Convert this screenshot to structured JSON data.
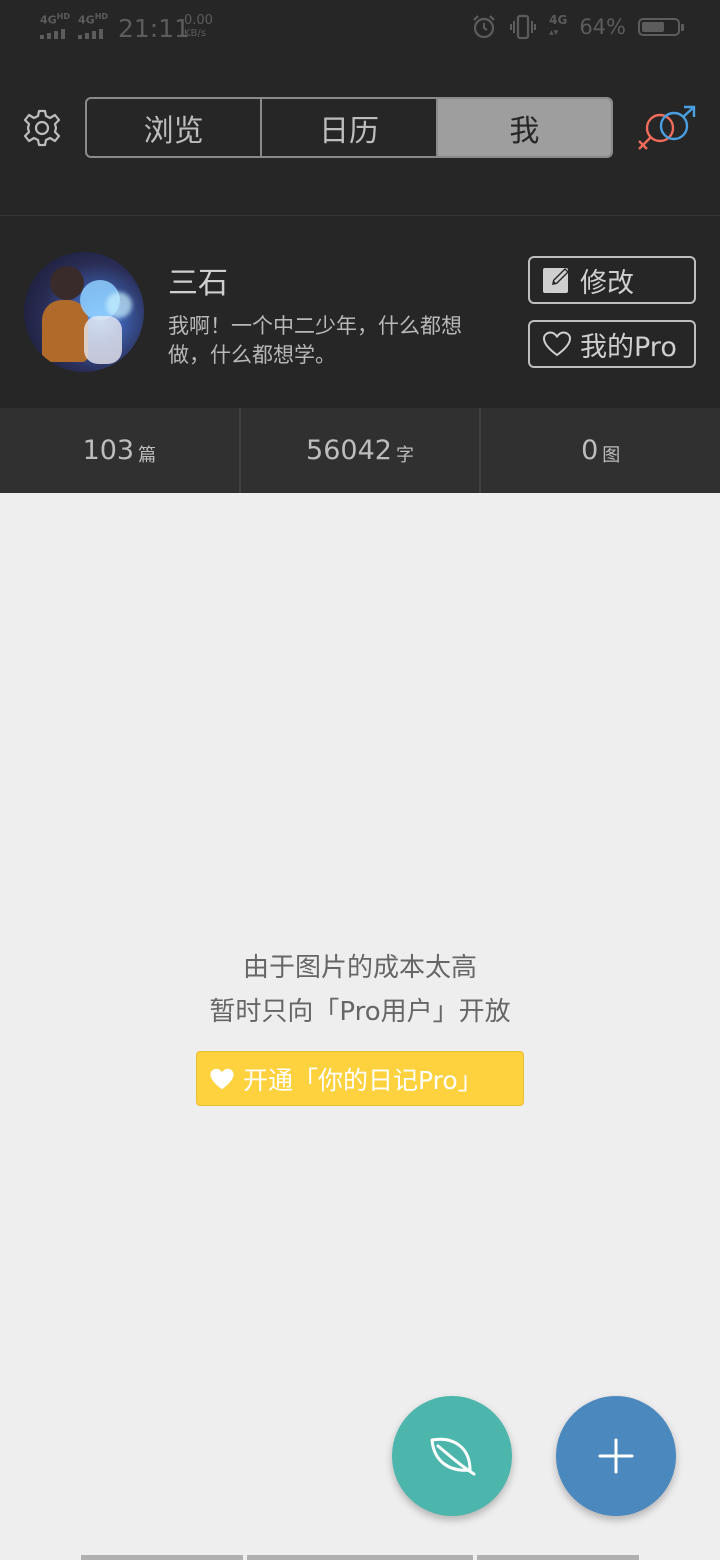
{
  "status_bar": {
    "network1": "4G",
    "network1_sup": "HD",
    "network2": "4G",
    "network2_sup": "HD",
    "time": "21:11",
    "speed_value": "0.00",
    "speed_unit": "KB/s",
    "network3": "4G",
    "battery_percent": "64%",
    "battery_level": 0.64
  },
  "header": {
    "tabs": [
      {
        "label": "浏览",
        "active": false
      },
      {
        "label": "日历",
        "active": false
      },
      {
        "label": "我",
        "active": true
      }
    ],
    "icons": {
      "settings": "gear-icon",
      "gender": "gender-icon"
    }
  },
  "profile": {
    "name": "三石",
    "bio": "我啊！一个中二少年，什么都想做，什么都想学。",
    "edit_label": "修改",
    "pro_label": "我的Pro"
  },
  "stats": [
    {
      "value": "103",
      "unit": "篇"
    },
    {
      "value": "56042",
      "unit": "字"
    },
    {
      "value": "0",
      "unit": "图"
    }
  ],
  "empty_state": {
    "line1": "由于图片的成本太高",
    "line2": "暂时只向「Pro用户」开放",
    "button_label": "开通「你的日记Pro」"
  },
  "colors": {
    "header_bg": "#262626",
    "stats_bg": "#303030",
    "pro_button": "#fed23f",
    "fab_leaf": "#4db6ac",
    "fab_add": "#4a88bd",
    "gender_female": "#f26c5b",
    "gender_male": "#4a9fe0"
  }
}
